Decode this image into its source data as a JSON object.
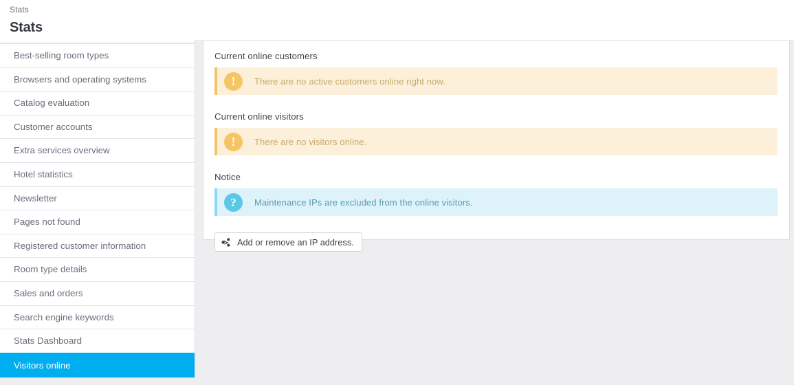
{
  "header": {
    "breadcrumb": "Stats",
    "title": "Stats"
  },
  "sidebar": {
    "items": [
      {
        "label": "",
        "partial": true,
        "active": false
      },
      {
        "label": "Best-selling room types",
        "partial": false,
        "active": false
      },
      {
        "label": "Browsers and operating systems",
        "partial": false,
        "active": false
      },
      {
        "label": "Catalog evaluation",
        "partial": false,
        "active": false
      },
      {
        "label": "Customer accounts",
        "partial": false,
        "active": false
      },
      {
        "label": "Extra services overview",
        "partial": false,
        "active": false
      },
      {
        "label": "Hotel statistics",
        "partial": false,
        "active": false
      },
      {
        "label": "Newsletter",
        "partial": false,
        "active": false
      },
      {
        "label": "Pages not found",
        "partial": false,
        "active": false
      },
      {
        "label": "Registered customer information",
        "partial": false,
        "active": false
      },
      {
        "label": "Room type details",
        "partial": false,
        "active": false
      },
      {
        "label": "Sales and orders",
        "partial": false,
        "active": false
      },
      {
        "label": "Search engine keywords",
        "partial": false,
        "active": false
      },
      {
        "label": "Stats Dashboard",
        "partial": false,
        "active": false
      },
      {
        "label": "Visitors online",
        "partial": false,
        "active": true
      }
    ],
    "active_color": "#00aeef"
  },
  "main": {
    "sections": [
      {
        "label": "Current online customers",
        "alert_type": "warning",
        "alert_icon": "exclamation-circle-icon",
        "alert_glyph": "!",
        "alert_text": "There are no active customers online right now."
      },
      {
        "label": "Current online visitors",
        "alert_type": "warning",
        "alert_icon": "exclamation-circle-icon",
        "alert_glyph": "!",
        "alert_text": "There are no visitors online."
      },
      {
        "label": "Notice",
        "alert_type": "info",
        "alert_icon": "question-circle-icon",
        "alert_glyph": "?",
        "alert_text": "Maintenance IPs are excluded from the online visitors."
      }
    ],
    "button": {
      "icon": "share-alt-icon",
      "label": "Add or remove an IP address."
    }
  },
  "colors": {
    "accent": "#00aeef",
    "warning_bg": "#fcf0da",
    "warning_border": "#f0c36d",
    "warning_icon": "#f5c563",
    "warning_text": "#c9a96b",
    "info_bg": "#def2fa",
    "info_border": "#8ed9f6",
    "info_icon": "#5bc8e8",
    "info_text": "#5a9db5",
    "page_bg": "#eeeef0"
  }
}
